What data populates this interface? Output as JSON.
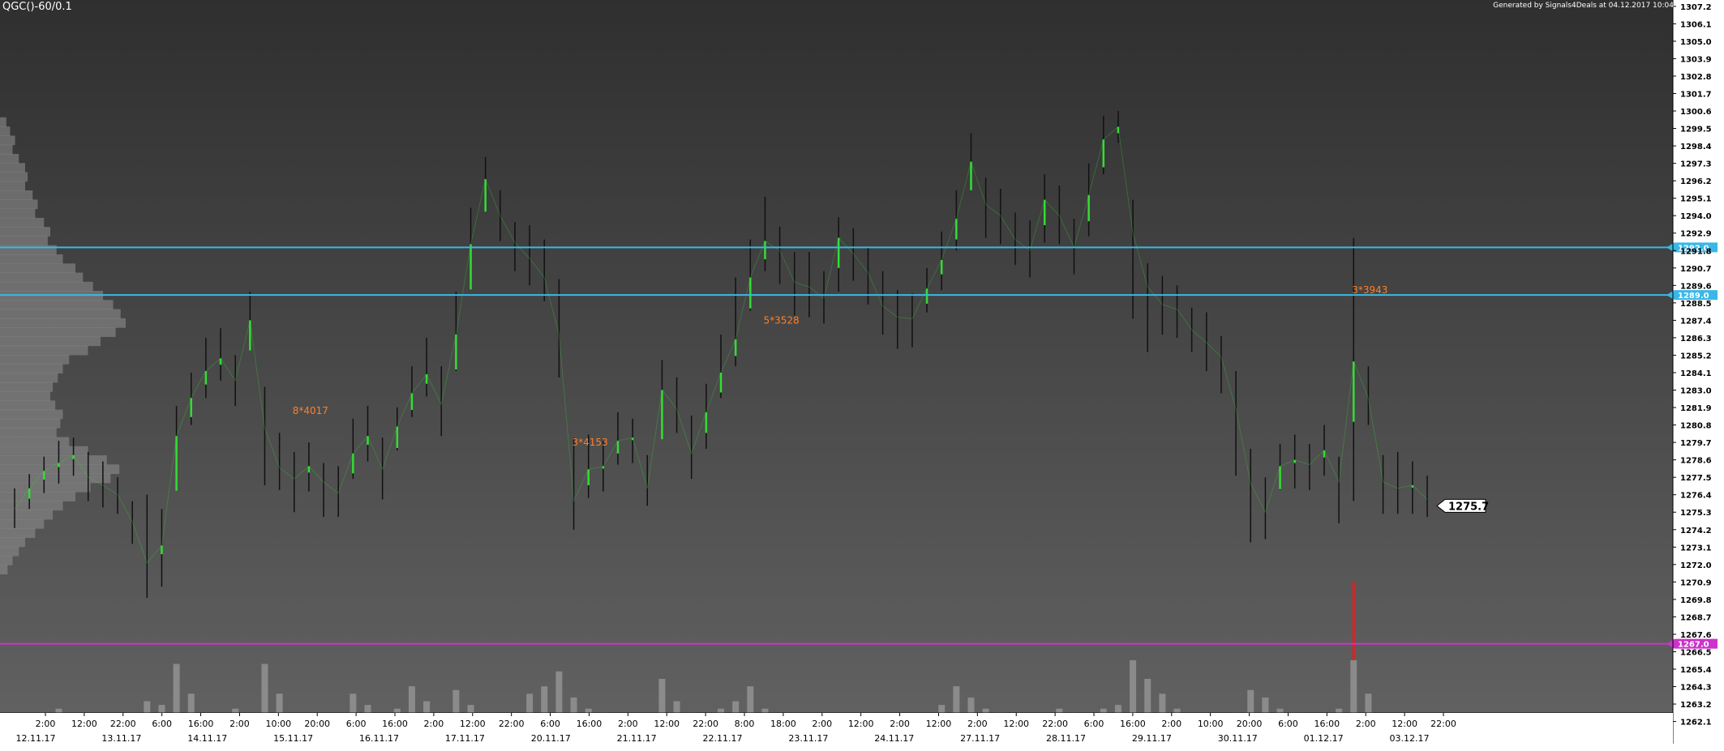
{
  "header": {
    "symbol": "QGC()-60/0.1",
    "generated": "Generated by Signals4Deals at 04.12.2017 10:04"
  },
  "colors": {
    "background_top": "#2f2f2f",
    "background_bottom": "#636363",
    "bar": "#111111",
    "up_highlight": "#33dd33",
    "level_line": "#39b8e8",
    "low_line": "#cc33cc",
    "annotation": "#ff7f27",
    "spike": "#e02020",
    "axis_text": "#ffffff"
  },
  "chart_data": {
    "type": "line",
    "title": "QGC()-60/0.1",
    "ylim": [
      1260.7,
      1307.6
    ],
    "y_ticks": [
      "1307.2",
      "1306.1",
      "1305.0",
      "1303.9",
      "1302.8",
      "1301.7",
      "1300.6",
      "1299.5",
      "1298.4",
      "1297.3",
      "1296.2",
      "1295.1",
      "1294.0",
      "1292.9",
      "1291.8",
      "1290.7",
      "1289.6",
      "1288.5",
      "1287.4",
      "1286.3",
      "1285.2",
      "1284.1",
      "1283.0",
      "1281.9",
      "1280.8",
      "1279.7",
      "1278.6",
      "1277.5",
      "1276.4",
      "1275.3",
      "1274.2",
      "1273.1",
      "1272.0",
      "1270.9",
      "1269.8",
      "1268.7",
      "1267.6",
      "1266.5",
      "1265.4",
      "1264.3",
      "1263.2",
      "1262.1"
    ],
    "time_ticks": [
      "2:00",
      "12:00",
      "22:00",
      "6:00",
      "16:00",
      "2:00",
      "10:00",
      "20:00",
      "6:00",
      "16:00",
      "2:00",
      "12:00",
      "22:00",
      "6:00",
      "16:00",
      "2:00",
      "12:00",
      "22:00",
      "8:00",
      "18:00",
      "2:00",
      "12:00",
      "2:00",
      "12:00",
      "2:00",
      "12:00",
      "22:00",
      "6:00",
      "16:00",
      "2:00",
      "10:00",
      "20:00",
      "6:00",
      "16:00",
      "2:00",
      "12:00",
      "22:00"
    ],
    "date_ticks": [
      "12.11.17",
      "13.11.17",
      "14.11.17",
      "15.11.17",
      "16.11.17",
      "17.11.17",
      "20.11.17",
      "21.11.17",
      "22.11.17",
      "23.11.17",
      "24.11.17",
      "27.11.17",
      "28.11.17",
      "29.11.17",
      "30.11.17",
      "01.12.17",
      "03.12.17"
    ],
    "series": [
      {
        "values": [
          1275.5,
          1276.8,
          1277.9,
          1278.4,
          1278.9,
          1277.5,
          1277.0,
          1276.4,
          1274.7,
          1272.1,
          1273.2,
          1280.1,
          1282.5,
          1284.2,
          1285.0,
          1283.6,
          1287.4,
          1280.6,
          1278.1,
          1277.4,
          1278.2,
          1277.2,
          1276.5,
          1279.0,
          1280.1,
          1278.0,
          1280.7,
          1282.8,
          1284.0,
          1282.1,
          1286.5,
          1292.2,
          1296.3,
          1294.0,
          1292.3,
          1291.3,
          1290.1,
          1286.5,
          1276.0,
          1278.0,
          1278.2,
          1279.8,
          1280.0,
          1276.8,
          1283.0,
          1281.8,
          1279.0,
          1281.6,
          1284.1,
          1286.2,
          1290.1,
          1292.4,
          1291.8,
          1289.8,
          1289.5,
          1288.8,
          1292.6,
          1291.6,
          1290.4,
          1288.3,
          1287.6,
          1287.5,
          1289.4,
          1291.2,
          1293.8,
          1297.4,
          1294.7,
          1294.0,
          1292.5,
          1291.8,
          1295.0,
          1294.0,
          1292.0,
          1295.3,
          1298.8,
          1299.6,
          1292.9,
          1289.5,
          1288.4,
          1288.1,
          1286.8,
          1286.0,
          1285.1,
          1281.8,
          1277.1,
          1275.3,
          1278.2,
          1278.6,
          1278.3,
          1279.2,
          1277.2,
          1284.8,
          1282.5,
          1277.2,
          1276.8,
          1277.0,
          1276.1
        ],
        "highs": [
          1276.8,
          1277.7,
          1278.8,
          1279.8,
          1280.0,
          1279.1,
          1278.5,
          1277.5,
          1276.0,
          1276.4,
          1275.5,
          1282.0,
          1284.1,
          1286.3,
          1286.9,
          1285.2,
          1289.2,
          1283.2,
          1280.3,
          1279.1,
          1279.7,
          1278.4,
          1278.2,
          1281.2,
          1282.0,
          1280.0,
          1281.9,
          1284.5,
          1286.3,
          1284.5,
          1289.2,
          1294.5,
          1297.7,
          1295.6,
          1293.6,
          1293.4,
          1292.5,
          1290.0,
          1280.0,
          1280.2,
          1279.8,
          1281.6,
          1281.2,
          1278.9,
          1284.9,
          1283.8,
          1281.4,
          1283.4,
          1286.5,
          1290.1,
          1292.5,
          1295.2,
          1293.3,
          1291.7,
          1291.7,
          1290.5,
          1293.9,
          1293.2,
          1292.0,
          1290.5,
          1289.3,
          1289.1,
          1290.7,
          1293.0,
          1295.6,
          1299.2,
          1296.4,
          1295.7,
          1294.2,
          1293.7,
          1296.6,
          1295.9,
          1293.8,
          1297.3,
          1300.3,
          1300.6,
          1295.0,
          1291.0,
          1290.2,
          1289.6,
          1288.2,
          1287.9,
          1286.4,
          1284.2,
          1279.3,
          1277.5,
          1279.6,
          1280.2,
          1279.6,
          1280.8,
          1278.8,
          1292.6,
          1284.5,
          1278.9,
          1279.1,
          1278.5,
          1277.6
        ],
        "lows": [
          1274.3,
          1275.5,
          1276.5,
          1277.1,
          1277.6,
          1276.0,
          1275.6,
          1275.2,
          1273.3,
          1269.9,
          1270.6,
          1277.5,
          1280.8,
          1282.5,
          1283.6,
          1282.0,
          1285.8,
          1277.0,
          1276.7,
          1275.3,
          1276.6,
          1275.0,
          1275.0,
          1277.4,
          1278.5,
          1276.1,
          1279.2,
          1281.3,
          1282.6,
          1280.1,
          1284.2,
          1289.8,
          1294.5,
          1292.4,
          1290.5,
          1289.6,
          1288.6,
          1283.8,
          1274.2,
          1276.2,
          1276.6,
          1278.3,
          1278.4,
          1275.7,
          1281.1,
          1280.3,
          1277.4,
          1279.3,
          1282.5,
          1284.5,
          1288.0,
          1290.5,
          1289.7,
          1287.7,
          1287.6,
          1287.2,
          1289.2,
          1289.9,
          1288.4,
          1286.5,
          1285.6,
          1285.7,
          1287.9,
          1289.3,
          1291.8,
          1295.6,
          1292.6,
          1292.2,
          1290.9,
          1290.1,
          1292.3,
          1292.2,
          1290.3,
          1292.7,
          1296.6,
          1298.6,
          1287.5,
          1285.4,
          1286.5,
          1286.3,
          1285.4,
          1284.2,
          1282.8,
          1277.6,
          1273.4,
          1273.6,
          1276.7,
          1276.8,
          1276.7,
          1277.6,
          1274.6,
          1276.0,
          1280.8,
          1275.2,
          1275.2,
          1275.2,
          1275.0
        ]
      }
    ],
    "level_lines": [
      {
        "value": 1292.0,
        "label": "1292.0",
        "color": "#39b8e8"
      },
      {
        "value": 1289.0,
        "label": "1289.0",
        "color": "#39b8e8"
      },
      {
        "value": 1267.0,
        "label": "1267.0",
        "color": "#cc33cc"
      }
    ],
    "current_price": {
      "value": 1275.7,
      "label": "1275.7"
    },
    "annotations": [
      {
        "text": "8*4017",
        "bar": 19,
        "price": 1281.7
      },
      {
        "text": "3*4153",
        "bar": 38,
        "price": 1279.7
      },
      {
        "text": "5*3528",
        "bar": 51,
        "price": 1287.4
      },
      {
        "text": "3*3943",
        "bar": 91,
        "price": 1289.3
      }
    ],
    "spike": {
      "bar": 91,
      "from": 1266.0,
      "to": 1270.9
    },
    "volume_profile": [
      0.05,
      0.08,
      0.12,
      0.1,
      0.15,
      0.2,
      0.22,
      0.2,
      0.26,
      0.3,
      0.28,
      0.35,
      0.4,
      0.38,
      0.45,
      0.5,
      0.6,
      0.66,
      0.74,
      0.82,
      0.9,
      0.96,
      1.0,
      0.92,
      0.8,
      0.7,
      0.55,
      0.5,
      0.46,
      0.42,
      0.4,
      0.44,
      0.5,
      0.48,
      0.45,
      0.55,
      0.7,
      0.85,
      0.95,
      0.88,
      0.72,
      0.6,
      0.5,
      0.42,
      0.35,
      0.28,
      0.2,
      0.15,
      0.1,
      0.06
    ],
    "volumes": [
      0.1,
      0.2,
      0.25,
      0.3,
      0.15,
      0.2,
      0.12,
      0.1,
      0.25,
      0.4,
      0.35,
      0.9,
      0.5,
      0.2,
      0.15,
      0.3,
      0.2,
      0.9,
      0.5,
      0.2,
      0.15,
      0.1,
      0.2,
      0.5,
      0.35,
      0.2,
      0.3,
      0.6,
      0.4,
      0.2,
      0.55,
      0.35,
      0.25,
      0.2,
      0.15,
      0.5,
      0.6,
      0.8,
      0.45,
      0.3,
      0.25,
      0.2,
      0.2,
      0.15,
      0.7,
      0.4,
      0.25,
      0.2,
      0.3,
      0.4,
      0.6,
      0.3,
      0.2,
      0.15,
      0.1,
      0.15,
      0.2,
      0.2,
      0.15,
      0.15,
      0.1,
      0.1,
      0.2,
      0.35,
      0.6,
      0.45,
      0.3,
      0.25,
      0.2,
      0.15,
      0.2,
      0.3,
      0.25,
      0.2,
      0.3,
      0.35,
      0.95,
      0.7,
      0.5,
      0.3,
      0.2,
      0.15,
      0.2,
      0.25,
      0.55,
      0.45,
      0.3,
      0.25,
      0.2,
      0.15,
      0.3,
      0.95,
      0.5,
      0.15,
      0.1,
      0.12,
      0.08
    ]
  }
}
